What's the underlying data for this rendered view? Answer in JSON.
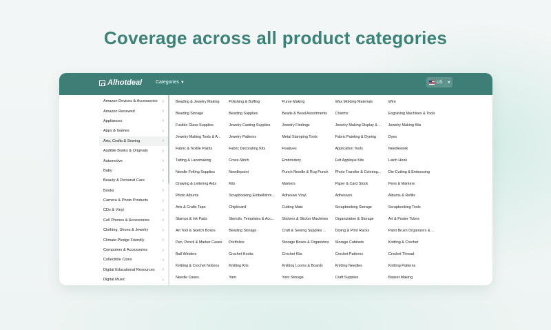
{
  "headline": "Coverage across all product categories",
  "header": {
    "logo_text": "Alhotdeal",
    "categories_label": "Categories",
    "region_label": "US",
    "bar_color": "#3d7f76"
  },
  "sidebar": {
    "active_index": 4,
    "items": [
      {
        "label": "Amazon Devices & Accessories"
      },
      {
        "label": "Amazon Renewed"
      },
      {
        "label": "Appliances"
      },
      {
        "label": "Apps & Games"
      },
      {
        "label": "Arts, Crafts & Sewing"
      },
      {
        "label": "Audible Books & Originals"
      },
      {
        "label": "Automotive"
      },
      {
        "label": "Baby"
      },
      {
        "label": "Beauty & Personal Care"
      },
      {
        "label": "Books"
      },
      {
        "label": "Camera & Photo Products"
      },
      {
        "label": "CDs & Vinyl"
      },
      {
        "label": "Cell Phones & Accessories"
      },
      {
        "label": "Clothing, Shoes & Jewelry"
      },
      {
        "label": "Climate Pledge Friendly"
      },
      {
        "label": "Computers & Accessories"
      },
      {
        "label": "Collectible Coins"
      },
      {
        "label": "Digital Educational Resources"
      },
      {
        "label": "Digital Music"
      }
    ]
  },
  "subcategories": [
    "Beading & Jewelry Making",
    "Polishing & Buffing",
    "Purse Making",
    "Wax Molding Materials",
    "Wire",
    "Beading Storage",
    "Beading Supplies",
    "Beads & Bead Assortments",
    "Charms",
    "Engraving Machines & Tools",
    "Fusible Glass Supplies",
    "Jewelry Casting Supplies",
    "Jewelry Findings",
    "Jewelry Making Display & ...",
    "Jewelry Making Kits",
    "Jewelry Making Tools & A...",
    "Jewelry Patterns",
    "Metal Stamping Tools",
    "Fabric Painting & Dyeing",
    "Dyes",
    "Fabric & Textile Paints",
    "Fabric Decorating Kits",
    "Fixatives",
    "Application Tools",
    "Needlework",
    "Tatting & Lacemaking",
    "Cross-Stitch",
    "Embroidery",
    "Felt Applique Kits",
    "Latch Hook",
    "Needle Felting Supplies",
    "Needlepoint",
    "Punch Needle & Rug Punch",
    "Photo Transfer & Coloring...",
    "Die-Cutting & Embossing",
    "Drawing & Lettering Aids",
    "Kits",
    "Markers",
    "Paper & Card Stock",
    "Pens & Markers",
    "Photo Albums",
    "Scrapbooking Embellishm...",
    "Adhesive Vinyl",
    "Adhesives",
    "Albums & Refills",
    "Arts & Crafts Tape",
    "Chipboard",
    "Cutting Mats",
    "Scrapbooking Storage",
    "Scrapbooking Tools",
    "Stamps & Ink Pads",
    "Stencils, Templates & Acc...",
    "Stickers & Sticker Machines",
    "Organization & Storage",
    "Art & Poster Tubes",
    "Art Tool & Sketch Boxes",
    "Beading Storage",
    "Craft & Sewing Supplies ...",
    "Drying & Print Racks",
    "Paint Brush Organizers & ...",
    "Pen, Pencil & Marker Cases",
    "Portfolios",
    "Storage Boxes & Organizers",
    "Storage Cabinets",
    "Knitting & Crochet",
    "Ball Winders",
    "Crochet Hooks",
    "Crochet Kits",
    "Crochet Patterns",
    "Crochet Thread",
    "Knitting & Crochet Notions",
    "Knitting Kits",
    "Knitting Looms & Boards",
    "Knitting Needles",
    "Knitting Patterns",
    "Needle Cases",
    "Yarn",
    "Yarn Storage",
    "Craft Supplies",
    "Basket Making"
  ]
}
